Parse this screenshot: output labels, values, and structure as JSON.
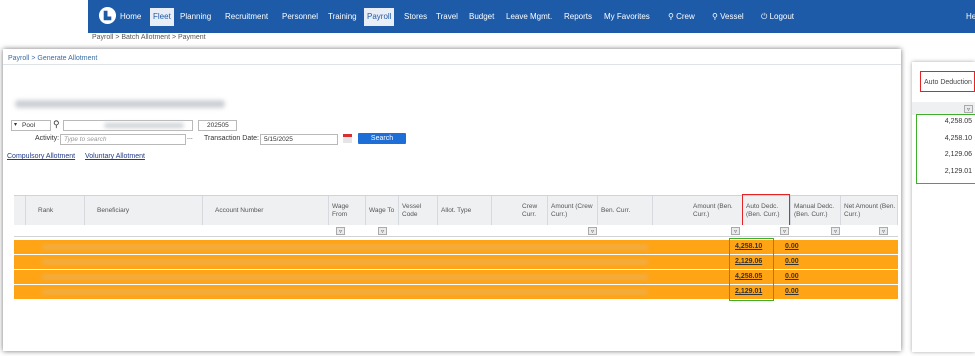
{
  "nav": {
    "items": [
      "Home",
      "Fleet",
      "Planning",
      "Recruitment",
      "Personnel",
      "Training",
      "Payroll",
      "Stores",
      "Travel",
      "Budget",
      "Leave Mgmt.",
      "Reports",
      "My Favorites",
      "Crew",
      "Vessel",
      "Logout",
      "He"
    ],
    "active": "Payroll",
    "accent": "#1d5aa8"
  },
  "breadcrumb_top": "Payroll > Batch Allotment > Payment",
  "panel": {
    "breadcrumb": "Payroll > Generate Allotment",
    "pool_select": "Pool",
    "pool_code": "202505",
    "activity_label": "Activity:",
    "activity_placeholder": "Type to search",
    "transaction_date_label": "Transaction Date:",
    "transaction_date": "5/15/2025",
    "search_button": "Search",
    "tabs": [
      "Compulsory Allotment",
      "Voluntary Allotment"
    ]
  },
  "table": {
    "columns": [
      "Rank",
      "Beneficiary",
      "Account Number",
      "Wage From",
      "Wage To",
      "Vessel Code",
      "Allot. Type",
      "Crew Curr.",
      "Amount (Crew Curr.)",
      "Ben. Curr.",
      "Amount (Ben. Curr.)",
      "Auto Dedc. (Ben. Curr.)",
      "Manual Dedc. (Ben. Curr.)",
      "Net Amount (Ben. Curr.)"
    ],
    "rows": [
      {
        "auto_dedc": "4,258.10",
        "manual_dedc": "0.00"
      },
      {
        "auto_dedc": "2,129.06",
        "manual_dedc": "0.00"
      },
      {
        "auto_dedc": "4,258.05",
        "manual_dedc": "0.00"
      },
      {
        "auto_dedc": "2,129.01",
        "manual_dedc": "0.00"
      }
    ],
    "row_color": "#ffa415"
  },
  "side_panel": {
    "header": "Auto Deduction",
    "values": [
      "4,258.05",
      "4,258.10",
      "2,129.06",
      "2,129.01"
    ]
  }
}
